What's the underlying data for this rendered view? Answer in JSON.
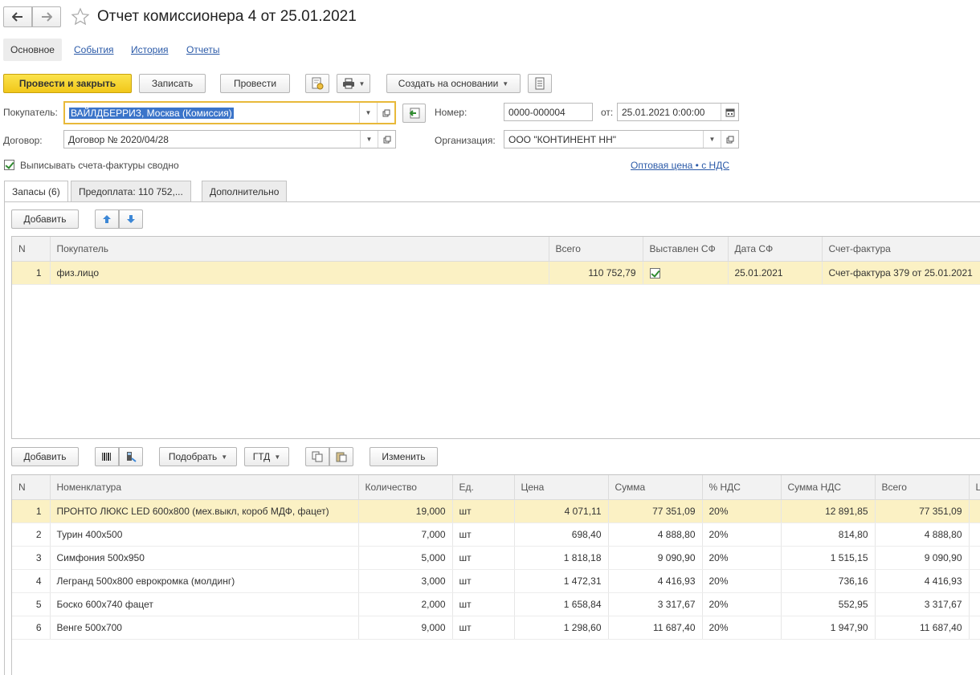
{
  "window": {
    "title": "Отчет комиссионера 4 от 25.01.2021",
    "nav_back_icon": "arrow-left-icon",
    "nav_forward_icon": "arrow-right-icon",
    "favorite_icon": "star-icon"
  },
  "top_tabs": [
    {
      "label": "Основное",
      "active": true
    },
    {
      "label": "События"
    },
    {
      "label": "История"
    },
    {
      "label": "Отчеты"
    }
  ],
  "toolbar": {
    "post_close": "Провести и закрыть",
    "save": "Записать",
    "post": "Провести",
    "create_based": "Создать на основании"
  },
  "form": {
    "buyer_label": "Покупатель:",
    "buyer_value": "ВАЙЛДБЕРРИЗ, Москва (Комиссия)",
    "contract_label": "Договор:",
    "contract_value": "Договор № 2020/04/28",
    "number_label": "Номер:",
    "number_value": "0000-000004",
    "date_label": "от:",
    "date_value": "25.01.2021  0:00:00",
    "org_label": "Организация:",
    "org_value": "ООО \"КОНТИНЕНТ НН\"",
    "invoice_summary_label": "Выписывать счета-фактуры сводно",
    "price_link": "Оптовая цена • с НДС"
  },
  "panel_tabs": [
    {
      "label": "Запасы (6)",
      "active": true
    },
    {
      "label": "Предоплата: 110 752,..."
    },
    {
      "label": "Дополнительно"
    }
  ],
  "upper_table": {
    "add_label": "Добавить",
    "columns": [
      "N",
      "Покупатель",
      "Всего",
      "Выставлен СФ",
      "Дата СФ",
      "Счет-фактура"
    ],
    "rows": [
      {
        "n": "1",
        "buyer": "физ.лицо",
        "total": "110 752,79",
        "issued": true,
        "date": "25.01.2021",
        "invoice": "Счет-фактура 379 от 25.01.2021"
      }
    ]
  },
  "lower_table": {
    "add_label": "Добавить",
    "pick_label": "Подобрать",
    "gtd_label": "ГТД",
    "change_label": "Изменить",
    "columns": [
      "N",
      "Номенклатура",
      "Количество",
      "Ед.",
      "Цена",
      "Сумма",
      "% НДС",
      "Сумма НДС",
      "Всего",
      "L"
    ],
    "rows": [
      {
        "n": "1",
        "name": "ПРОНТО ЛЮКС LED 600х800 (мех.выкл, короб МДФ, фацет)",
        "qty": "19,000",
        "unit": "шт",
        "price": "4 071,11",
        "sum": "77 351,09",
        "vat": "20%",
        "vat_sum": "12 891,85",
        "total": "77 351,09"
      },
      {
        "n": "2",
        "name": "Турин 400х500",
        "qty": "7,000",
        "unit": "шт",
        "price": "698,40",
        "sum": "4 888,80",
        "vat": "20%",
        "vat_sum": "814,80",
        "total": "4 888,80"
      },
      {
        "n": "3",
        "name": "Симфония 500х950",
        "qty": "5,000",
        "unit": "шт",
        "price": "1 818,18",
        "sum": "9 090,90",
        "vat": "20%",
        "vat_sum": "1 515,15",
        "total": "9 090,90"
      },
      {
        "n": "4",
        "name": "Легранд 500х800 еврокромка (молдинг)",
        "qty": "3,000",
        "unit": "шт",
        "price": "1 472,31",
        "sum": "4 416,93",
        "vat": "20%",
        "vat_sum": "736,16",
        "total": "4 416,93"
      },
      {
        "n": "5",
        "name": "Боско 600х740 фацет",
        "qty": "2,000",
        "unit": "шт",
        "price": "1 658,84",
        "sum": "3 317,67",
        "vat": "20%",
        "vat_sum": "552,95",
        "total": "3 317,67"
      },
      {
        "n": "6",
        "name": "Венге 500х700",
        "qty": "9,000",
        "unit": "шт",
        "price": "1 298,60",
        "sum": "11 687,40",
        "vat": "20%",
        "vat_sum": "1 947,90",
        "total": "11 687,40"
      }
    ]
  },
  "colors": {
    "primary_button": "#f4cf2a",
    "selected_row": "#fbf1c4",
    "link": "#2b5aa8",
    "focus_border": "#e8b93a"
  }
}
